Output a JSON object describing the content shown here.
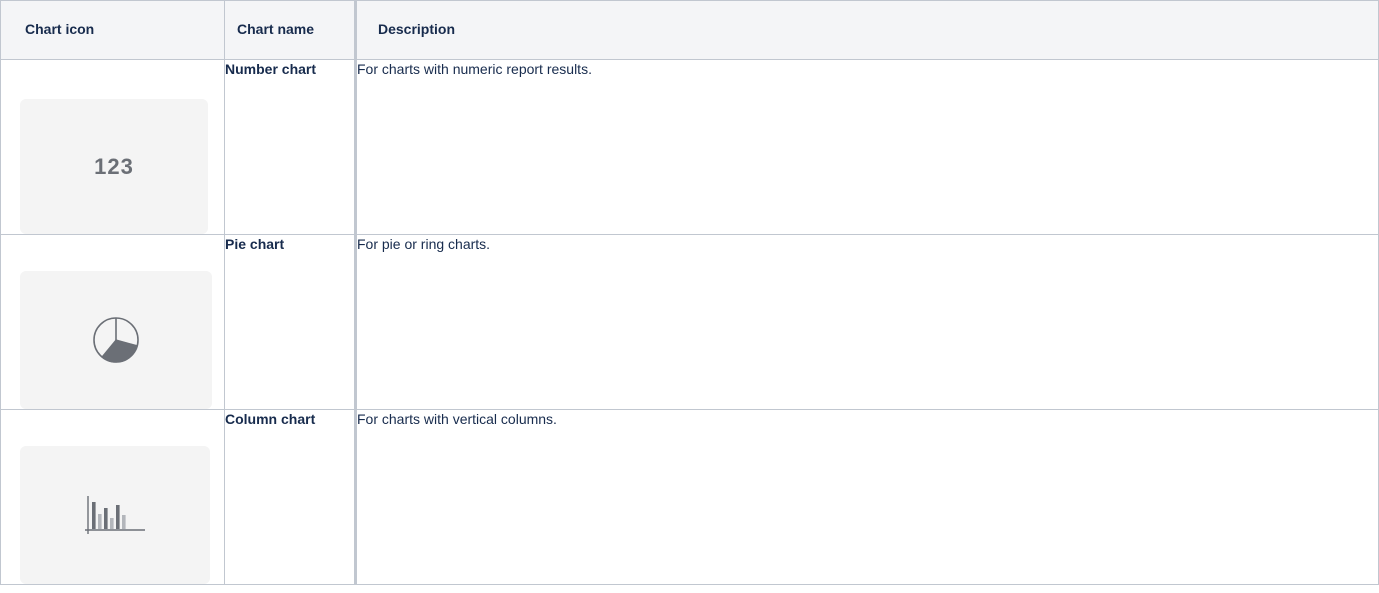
{
  "table": {
    "headers": [
      "Chart icon",
      "Chart name",
      "Description"
    ],
    "rows": [
      {
        "icon": "number-chart-icon",
        "icon_text": "123",
        "name": "Number chart",
        "description": "For charts with numeric report results."
      },
      {
        "icon": "pie-chart-icon",
        "name": "Pie chart",
        "description": "For pie or ring charts."
      },
      {
        "icon": "column-chart-icon",
        "name": "Column chart",
        "description": "For charts with vertical columns."
      }
    ]
  },
  "colors": {
    "header_bg": "#f4f5f7",
    "border": "#c1c7d0",
    "icon_card_bg": "#f4f4f4",
    "icon_gray": "#6b6f76"
  }
}
